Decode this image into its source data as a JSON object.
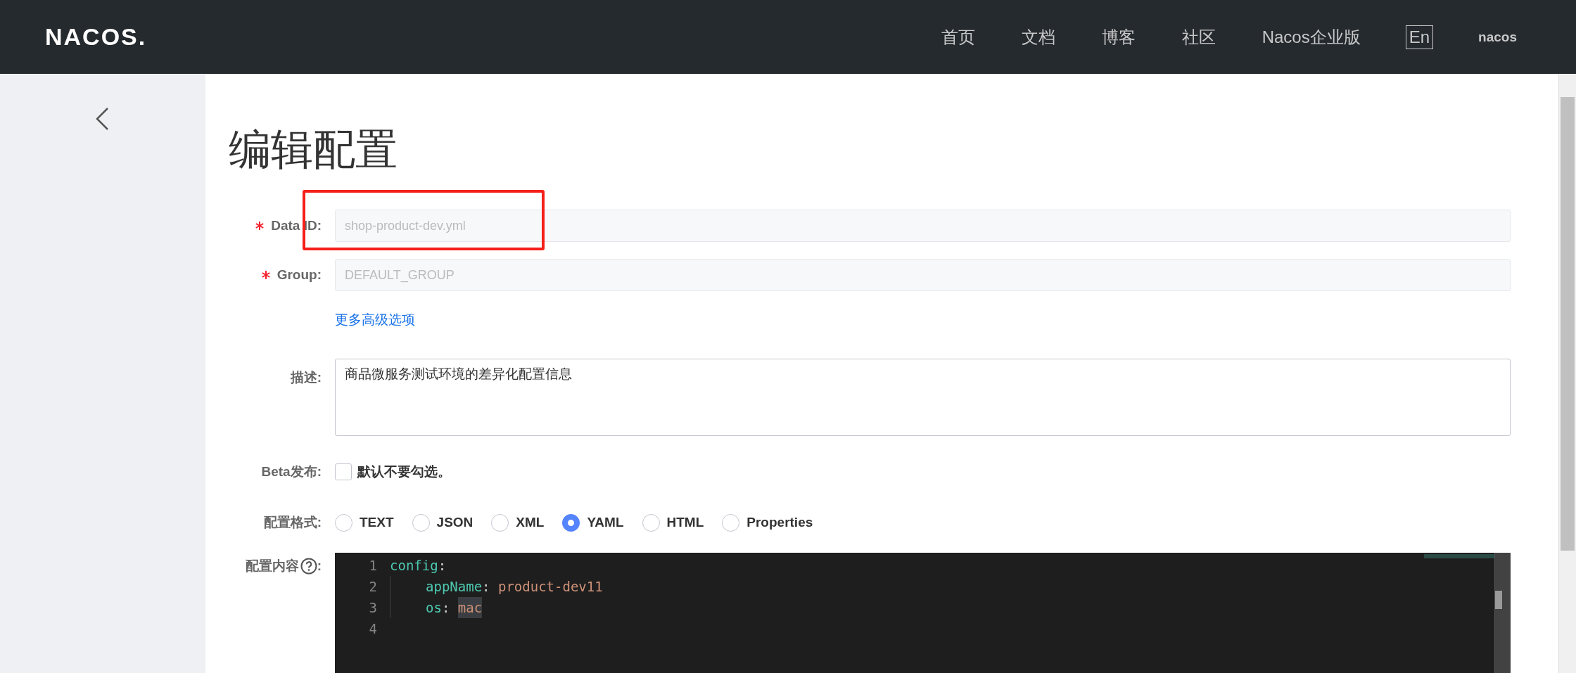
{
  "header": {
    "logo": "NACOS.",
    "nav": [
      "首页",
      "文档",
      "博客",
      "社区",
      "Nacos企业版"
    ],
    "language": "En",
    "user": "nacos"
  },
  "title": "编辑配置",
  "fields": [
    {
      "kind": "input",
      "label": "Data ID:",
      "required": true,
      "value": "shop-product-dev.yml",
      "disabled": true,
      "highlighted": true
    },
    {
      "kind": "input",
      "label": "Group:",
      "required": true,
      "value": "DEFAULT_GROUP",
      "disabled": true
    },
    {
      "kind": "link",
      "text": "更多高级选项"
    },
    {
      "kind": "textarea",
      "label": "描述:",
      "value": "商品微服务测试环境的差异化配置信息"
    },
    {
      "kind": "checkbox",
      "label": "Beta发布:",
      "text": "默认不要勾选。",
      "checked": false
    },
    {
      "kind": "radio",
      "label": "配置格式:",
      "options": [
        {
          "label": "TEXT",
          "selected": false
        },
        {
          "label": "JSON",
          "selected": false
        },
        {
          "label": "XML",
          "selected": false
        },
        {
          "label": "YAML",
          "selected": true
        },
        {
          "label": "HTML",
          "selected": false
        },
        {
          "label": "Properties",
          "selected": false
        }
      ]
    },
    {
      "kind": "editor",
      "label": "配置内容",
      "label_suffix": ":",
      "lines": [
        {
          "number": "1",
          "indented": false,
          "tokens": [
            {
              "kind": "key",
              "text": "config"
            },
            {
              "kind": "punct",
              "text": ":"
            }
          ]
        },
        {
          "number": "2",
          "indented": true,
          "tokens": [
            {
              "kind": "key",
              "text": "appName"
            },
            {
              "kind": "punct",
              "text": ": "
            },
            {
              "kind": "value",
              "text": "product-dev11"
            }
          ]
        },
        {
          "number": "3",
          "indented": true,
          "tokens": [
            {
              "kind": "key",
              "text": "os"
            },
            {
              "kind": "punct",
              "text": ": "
            },
            {
              "kind": "match",
              "text": "mac"
            }
          ]
        },
        {
          "number": "4",
          "indented": false
        }
      ]
    }
  ]
}
